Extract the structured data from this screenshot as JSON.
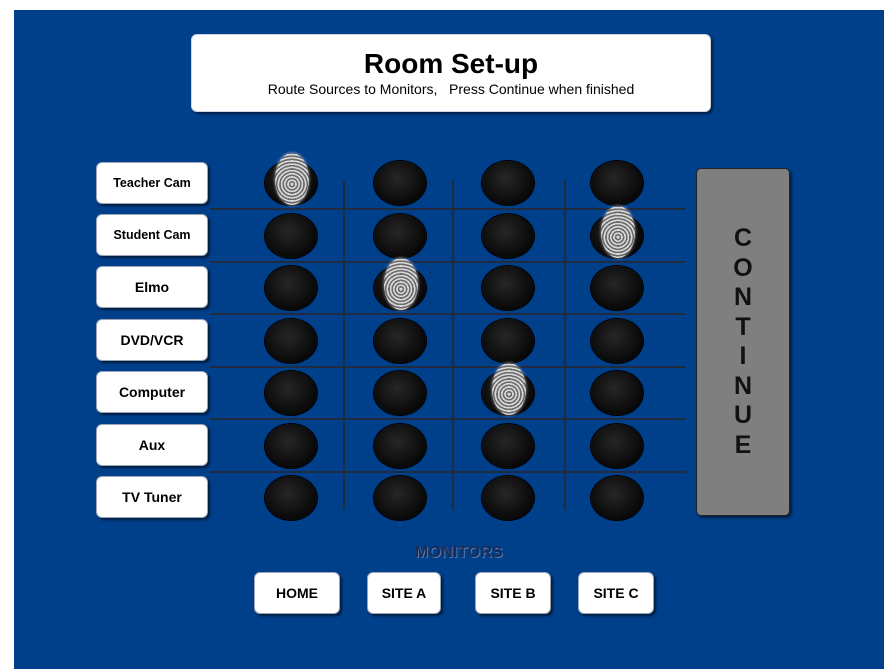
{
  "header": {
    "title": "Room Set-up",
    "subtitle": "Route Sources to Monitors,   Press Continue when finished"
  },
  "sources": [
    "Teacher Cam",
    "Student Cam",
    "Elmo",
    "DVD/VCR",
    "Computer",
    "Aux",
    "TV Tuner"
  ],
  "monitors": {
    "label": "MONITORS",
    "items": [
      "HOME",
      "SITE A",
      "SITE B",
      "SITE C"
    ]
  },
  "routes": [
    {
      "source": "Teacher Cam",
      "monitor": "HOME"
    },
    {
      "source": "Student Cam",
      "monitor": "SITE C"
    },
    {
      "source": "Elmo",
      "monitor": "SITE A"
    },
    {
      "source": "Computer",
      "monitor": "SITE B"
    }
  ],
  "continue_letters": [
    "C",
    "O",
    "N",
    "T",
    "I",
    "N",
    "U",
    "E"
  ],
  "colors": {
    "background": "#003f8a",
    "button": "#ffffff",
    "continue": "#7f7f7f",
    "node": "#0a0a0a"
  },
  "icons": {
    "selected_node": "fingerprint-icon"
  }
}
